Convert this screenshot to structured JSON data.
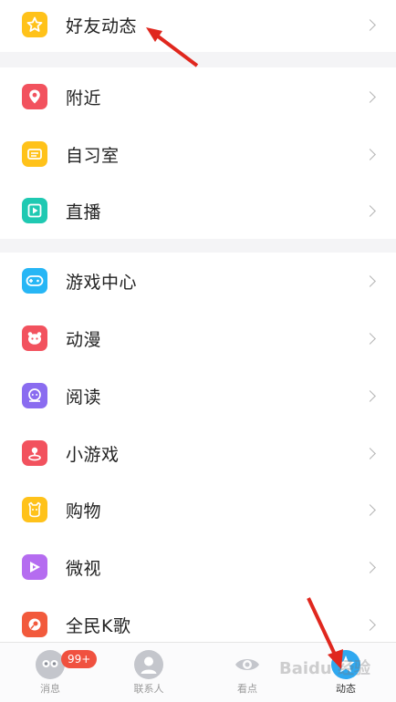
{
  "menu": {
    "group1": [
      {
        "label": "好友动态",
        "icon": "star-icon",
        "color": "#ffc21a"
      }
    ],
    "group2": [
      {
        "label": "附近",
        "icon": "location-pin-icon",
        "color": "#f2525e"
      },
      {
        "label": "自习室",
        "icon": "study-room-icon",
        "color": "#ffc21a"
      },
      {
        "label": "直播",
        "icon": "live-icon",
        "color": "#1fc9b2"
      }
    ],
    "group3": [
      {
        "label": "游戏中心",
        "icon": "gamepad-icon",
        "color": "#27b6f5"
      },
      {
        "label": "动漫",
        "icon": "anime-icon",
        "color": "#f2525e"
      },
      {
        "label": "阅读",
        "icon": "reading-icon",
        "color": "#8a6cf0"
      },
      {
        "label": "小游戏",
        "icon": "joystick-icon",
        "color": "#f2525e"
      },
      {
        "label": "购物",
        "icon": "shopping-icon",
        "color": "#ffc21a"
      },
      {
        "label": "微视",
        "icon": "weishi-icon",
        "color": "#b56cf0"
      },
      {
        "label": "全民K歌",
        "icon": "karaoke-icon",
        "color": "#f25a3c"
      }
    ]
  },
  "tabbar": {
    "tabs": [
      {
        "label": "消息",
        "icon": "messages-icon"
      },
      {
        "label": "联系人",
        "icon": "contacts-icon"
      },
      {
        "label": "看点",
        "icon": "eye-icon"
      },
      {
        "label": "动态",
        "icon": "star-icon",
        "active": true
      }
    ],
    "badge": "99+"
  },
  "watermark": "Baidu 经验"
}
